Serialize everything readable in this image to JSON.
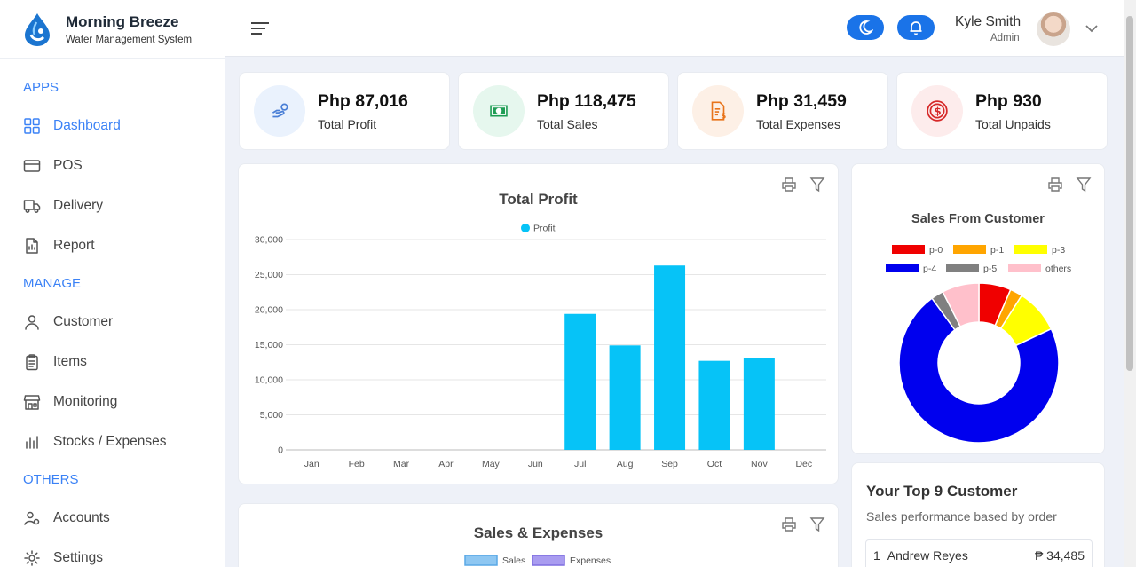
{
  "brand": {
    "title": "Morning Breeze",
    "subtitle": "Water Management System"
  },
  "sidebar": {
    "sections": [
      {
        "label": "APPS",
        "items": [
          {
            "label": "Dashboard",
            "icon": "grid-icon",
            "active": true
          },
          {
            "label": "POS",
            "icon": "card-icon"
          },
          {
            "label": "Delivery",
            "icon": "truck-icon"
          },
          {
            "label": "Report",
            "icon": "report-icon"
          }
        ]
      },
      {
        "label": "MANAGE",
        "items": [
          {
            "label": "Customer",
            "icon": "user-icon"
          },
          {
            "label": "Items",
            "icon": "clipboard-icon"
          },
          {
            "label": "Monitoring",
            "icon": "store-icon"
          },
          {
            "label": "Stocks / Expenses",
            "icon": "bars-icon"
          }
        ]
      },
      {
        "label": "OTHERS",
        "items": [
          {
            "label": "Accounts",
            "icon": "users-gear-icon"
          },
          {
            "label": "Settings",
            "icon": "gear-icon"
          }
        ]
      }
    ]
  },
  "header": {
    "user_name": "Kyle Smith",
    "user_role": "Admin"
  },
  "stats": [
    {
      "value": "Php 87,016",
      "label": "Total Profit",
      "icon": "hand-coin-icon",
      "bg": "#eaf2fd",
      "color": "#4a7fd6"
    },
    {
      "value": "Php 118,475",
      "label": "Total Sales",
      "icon": "cash-icon",
      "bg": "#e6f7ee",
      "color": "#1f9d55"
    },
    {
      "value": "Php 31,459",
      "label": "Total Expenses",
      "icon": "invoice-icon",
      "bg": "#fdf0e6",
      "color": "#e8731a"
    },
    {
      "value": "Php 930",
      "label": "Total Unpaids",
      "icon": "dollar-circle-icon",
      "bg": "#fdecec",
      "color": "#d62828"
    }
  ],
  "colors": {
    "accent": "#3b82f6",
    "bar": "#06c3f7",
    "toggle": "#1a73e8"
  },
  "chart_data": [
    {
      "type": "bar",
      "title": "Total Profit",
      "categories": [
        "Jan",
        "Feb",
        "Mar",
        "Apr",
        "May",
        "Jun",
        "Jul",
        "Aug",
        "Sep",
        "Oct",
        "Nov",
        "Dec"
      ],
      "series": [
        {
          "name": "Profit",
          "values": [
            0,
            0,
            0,
            0,
            0,
            0,
            19400,
            14900,
            26300,
            12700,
            13100,
            0
          ],
          "color": "#06c3f7"
        }
      ],
      "yticks": [
        "0",
        "5,000",
        "10,000",
        "15,000",
        "20,000",
        "25,000",
        "30,000"
      ],
      "ylim": [
        0,
        30000
      ],
      "legend": "top",
      "grid": true
    },
    {
      "type": "pie",
      "title": "Sales From Customer",
      "donut": true,
      "legend": "top",
      "slices": [
        {
          "label": "p-0",
          "value": 6.5,
          "color": "#f00000"
        },
        {
          "label": "p-1",
          "value": 2.5,
          "color": "#ffa500"
        },
        {
          "label": "p-3",
          "value": 9.0,
          "color": "#ffff00"
        },
        {
          "label": "p-4",
          "value": 72.0,
          "color": "#0000ee"
        },
        {
          "label": "p-5",
          "value": 2.5,
          "color": "#808080"
        },
        {
          "label": "others",
          "value": 7.5,
          "color": "#ffc0cb"
        }
      ]
    },
    {
      "type": "bar",
      "title": "Sales & Expenses",
      "series": [
        {
          "name": "Sales",
          "color": "#8ec7f2"
        },
        {
          "name": "Expenses",
          "color": "#a99cf0"
        }
      ],
      "legend": "top"
    }
  ],
  "top_customers": {
    "title": "Your Top 9 Customer",
    "subtitle": "Sales performance based by order",
    "rows": [
      {
        "rank": "1",
        "name": "Andrew Reyes",
        "amount": "₱ 34,485"
      }
    ]
  }
}
